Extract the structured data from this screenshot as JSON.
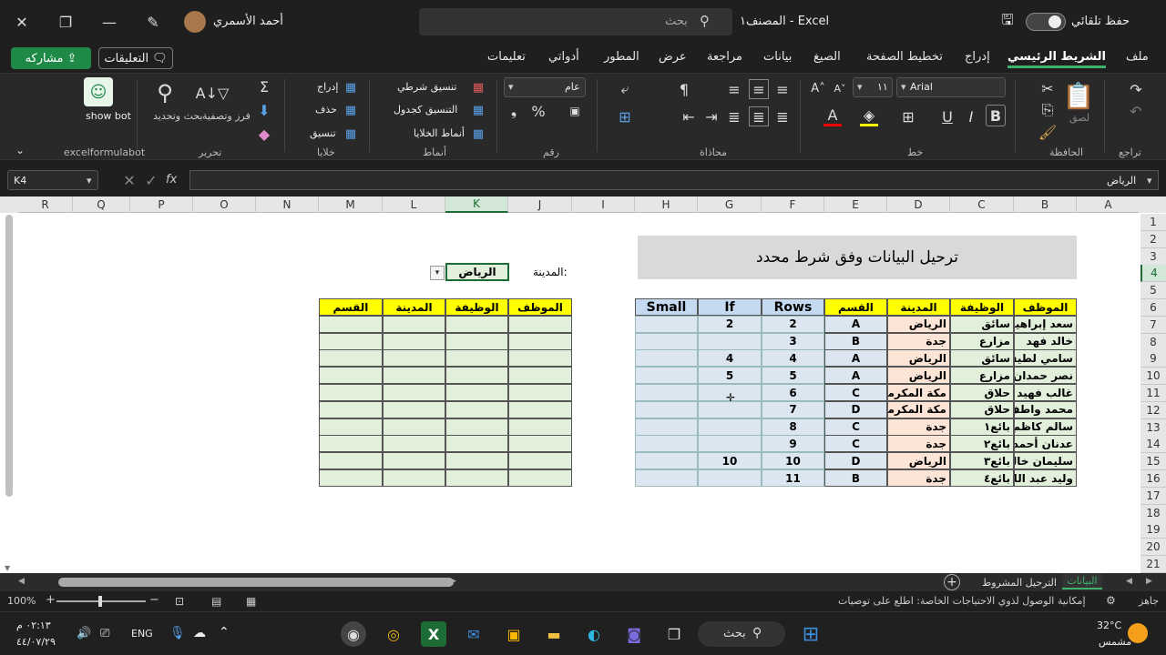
{
  "titlebar": {
    "user_name": "أحمد الأسمري",
    "search_placeholder": "بحث",
    "doc_title": "المصنف١  -  Excel",
    "autosave_label": "حفظ تلقائي"
  },
  "menubar": {
    "items": [
      "ملف",
      "الشريط الرئيسي",
      "إدراج",
      "تخطيط الصفحة",
      "الصيغ",
      "بيانات",
      "مراجعة",
      "عرض",
      "المطور",
      "أدواتي",
      "تعليمات"
    ],
    "comments_label": "التعليقات",
    "share_label": "مشاركه"
  },
  "ribbon": {
    "groups": {
      "undo": "تراجع",
      "clipboard": "الحافظة",
      "font": "خط",
      "alignment": "محاذاة",
      "number": "رقم",
      "styles": "أنماط",
      "cells": "خلايا",
      "editing": "تحرير",
      "bot": "excelformulabot"
    },
    "paste_label": "لصق",
    "font_name": "Arial",
    "font_size": "١١",
    "number_format": "عام",
    "conditional_format": "تنسيق شرطي",
    "format_as_table": "التنسيق كجدول",
    "cell_styles": "أنماط الخلايا",
    "insert": "إدراج",
    "delete": "حذف",
    "format": "تنسيق",
    "sort_filter": "فرز وتصفية",
    "find_select": "بحث وتحديد",
    "show_bot": "show bot"
  },
  "formula_bar": {
    "name_box": "K4",
    "fx": "fx",
    "value": "الرياض"
  },
  "sheet": {
    "columns": [
      "R",
      "Q",
      "P",
      "O",
      "N",
      "M",
      "L",
      "K",
      "J",
      "I",
      "H",
      "G",
      "F",
      "E",
      "D",
      "C",
      "B",
      "A"
    ],
    "rows": [
      "1",
      "2",
      "3",
      "4",
      "5",
      "6",
      "7",
      "8",
      "9",
      "10",
      "11",
      "12",
      "13",
      "14",
      "15",
      "16",
      "17",
      "18",
      "19",
      "20",
      "21"
    ],
    "title": "ترحيل البيانات وفق شرط محدد",
    "city_label": "المدينة:",
    "city_value": "الرياض",
    "left_table": {
      "headers": [
        "الموظف",
        "الوظيفة",
        "المدينة",
        "القسم",
        "Rows",
        "If",
        "Small"
      ],
      "rows": [
        [
          "سعد إبراهيم",
          "سائق",
          "الرياض",
          "A",
          "2",
          "2",
          ""
        ],
        [
          "خالد فهد",
          "مزارع",
          "جدة",
          "B",
          "3",
          "",
          ""
        ],
        [
          "سامي لطيف",
          "سائق",
          "الرياض",
          "A",
          "4",
          "4",
          ""
        ],
        [
          "نصر حمدان",
          "مزارع",
          "الرياض",
          "A",
          "5",
          "5",
          ""
        ],
        [
          "غالب فهيد",
          "حلاق",
          "مكة المكرمة",
          "C",
          "6",
          "",
          ""
        ],
        [
          "محمد واطف",
          "حلاق",
          "مكة المكرمة",
          "D",
          "7",
          "",
          ""
        ],
        [
          "سالم كاظم",
          "بائع١",
          "جدة",
          "C",
          "8",
          "",
          ""
        ],
        [
          "عدنان أحمد",
          "بائع٢",
          "جدة",
          "C",
          "9",
          "",
          ""
        ],
        [
          "سليمان خالد",
          "بائع٣",
          "الرياض",
          "D",
          "10",
          "10",
          ""
        ],
        [
          "وليد عبد الله",
          "بائع٤",
          "جدة",
          "B",
          "11",
          "",
          ""
        ]
      ]
    },
    "right_table": {
      "headers": [
        "الموظف",
        "الوظيفة",
        "المدينة",
        "القسم"
      ]
    }
  },
  "tabs": {
    "active": "البيانات",
    "other": "الترحيل المشروط"
  },
  "status": {
    "ready": "جاهز",
    "accessibility": "إمكانية الوصول لذوي الاحتياجات الخاصة: اطلع على توصيات",
    "zoom": "100%"
  },
  "taskbar": {
    "search": "بحث",
    "lang": "ENG",
    "time": "٠٢:١٣ م",
    "date": "٤٤/٠٧/٢٩",
    "temp": "32°C",
    "weather": "مشمس"
  }
}
